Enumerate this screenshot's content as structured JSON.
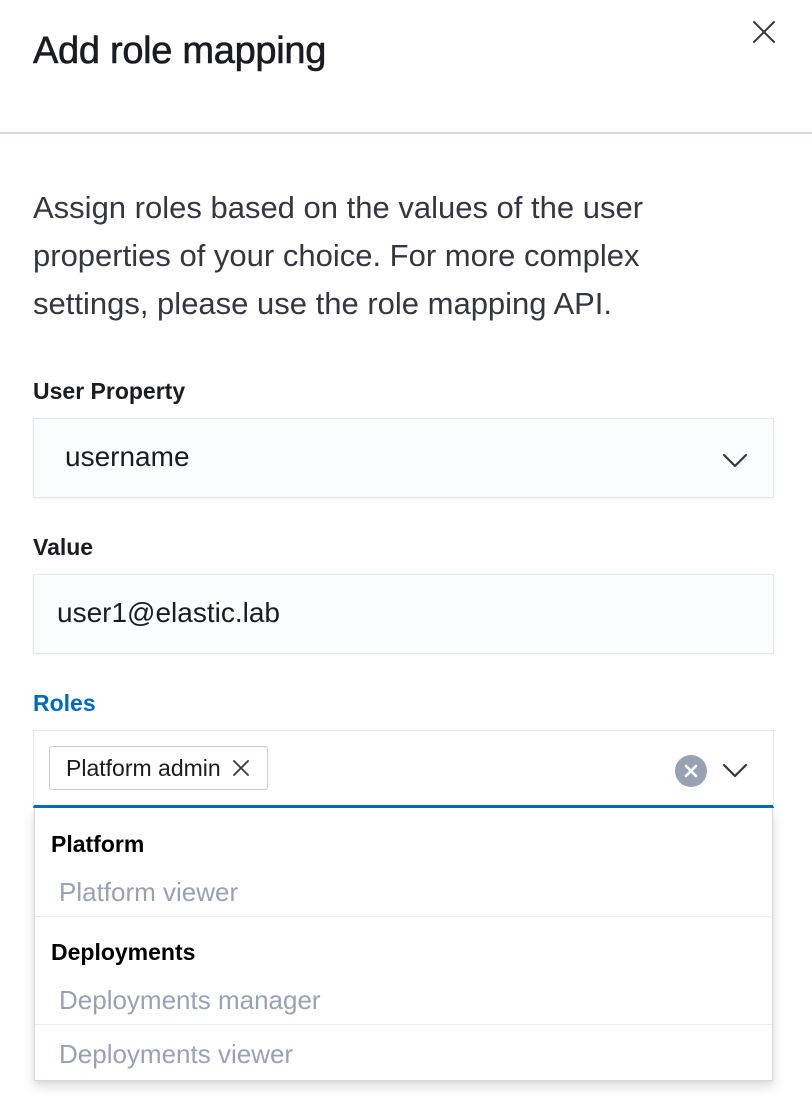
{
  "flyout": {
    "title": "Add role mapping",
    "description": "Assign roles based on the values of the user properties of your choice. For more complex settings, please use the role mapping API."
  },
  "user_property": {
    "label": "User Property",
    "selected": "username"
  },
  "value": {
    "label": "Value",
    "text": "user1@elastic.lab"
  },
  "roles": {
    "label": "Roles",
    "label_color": "#006bb8",
    "selected_chips": [
      "Platform admin"
    ],
    "groups": [
      {
        "title": "Platform",
        "options": [
          "Platform viewer"
        ]
      },
      {
        "title": "Deployments",
        "options": [
          "Deployments manager",
          "Deployments viewer"
        ]
      }
    ]
  },
  "icons": {
    "close": "close-icon",
    "chevron": "chevron-down-icon",
    "clear": "clear-circle-icon",
    "chip_remove": "cross-icon"
  }
}
